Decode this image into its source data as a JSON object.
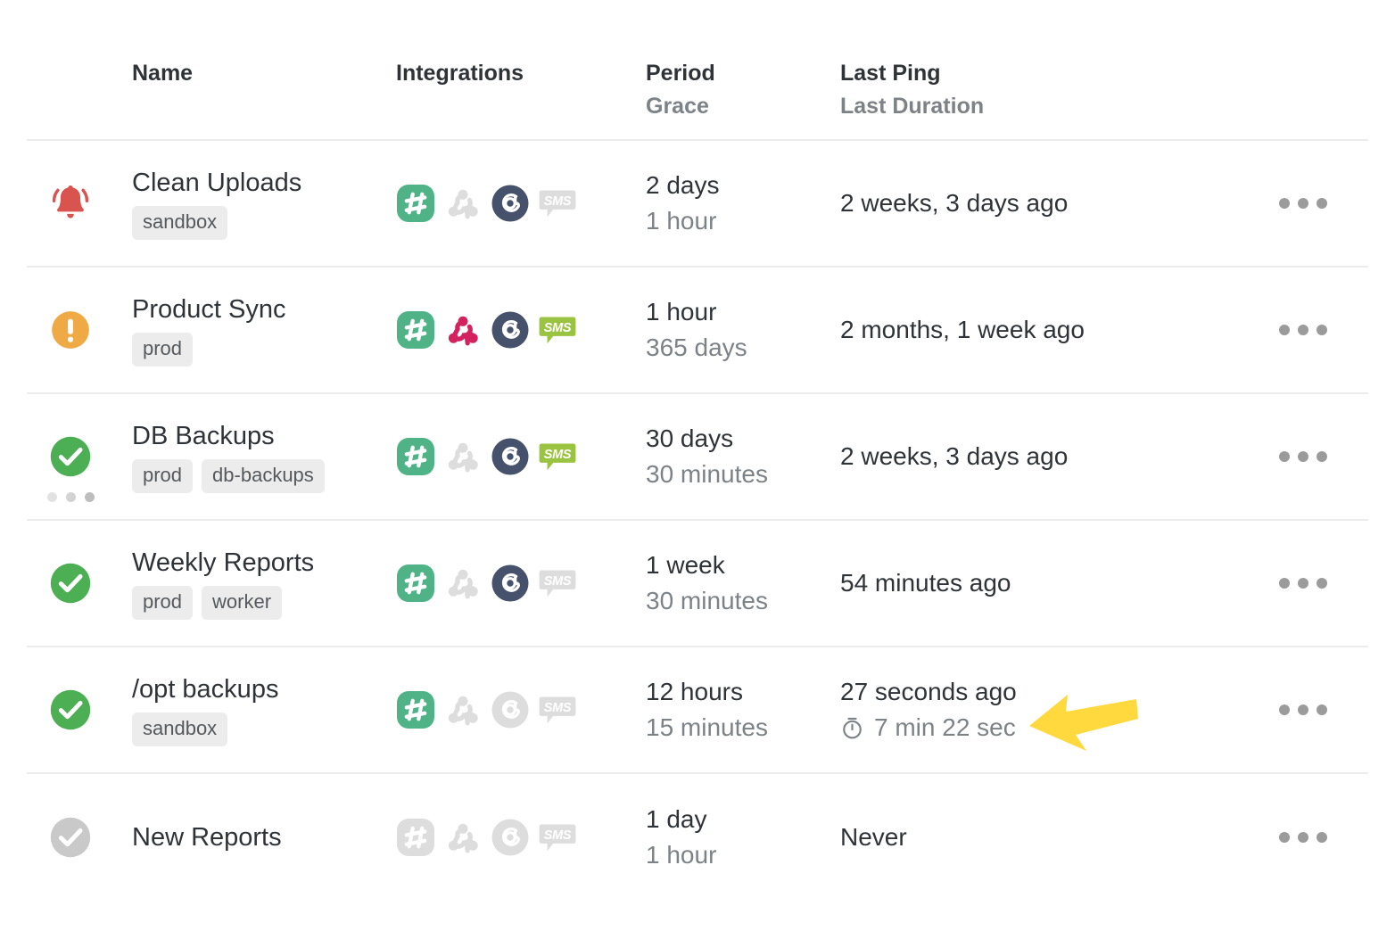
{
  "table": {
    "columns": [
      {
        "id": "status",
        "main": "",
        "sub": ""
      },
      {
        "id": "name",
        "main": "Name",
        "sub": ""
      },
      {
        "id": "integrations",
        "main": "Integrations",
        "sub": ""
      },
      {
        "id": "period",
        "main": "Period",
        "sub": "Grace"
      },
      {
        "id": "last_ping",
        "main": "Last Ping",
        "sub": "Last Duration"
      },
      {
        "id": "actions",
        "main": "",
        "sub": ""
      }
    ],
    "actions_label": "options-menu"
  },
  "colors": {
    "status_down": "#d9534f",
    "status_grace": "#efa945",
    "status_up": "#4caf54",
    "status_new": "#c9c9c9",
    "integration_slack_on": "#4fb387",
    "integration_webhook_on": "#d4225e",
    "integration_email_on": "#46526b",
    "integration_sms_on": "#9bc342",
    "integration_off": "#dddddd",
    "text_primary": "#2f3338",
    "text_muted": "#7d8287",
    "tag_bg": "#ececec",
    "row_divider": "#ececec",
    "annotation_arrow": "#ffd93d"
  },
  "rows": [
    {
      "status": "down",
      "status_icon": "alarm-bell-icon",
      "spinner": false,
      "name": "Clean Uploads",
      "tags": [
        "sandbox"
      ],
      "integrations": [
        {
          "icon": "slack-icon",
          "active": true
        },
        {
          "icon": "webhook-icon",
          "active": false
        },
        {
          "icon": "email-icon",
          "active": true
        },
        {
          "icon": "sms-icon",
          "active": false
        }
      ],
      "period": "2 days",
      "grace": "1 hour",
      "last_ping": "2 weeks, 3 days ago",
      "last_duration": ""
    },
    {
      "status": "grace",
      "status_icon": "exclamation-circle-icon",
      "spinner": false,
      "name": "Product Sync",
      "tags": [
        "prod"
      ],
      "integrations": [
        {
          "icon": "slack-icon",
          "active": true
        },
        {
          "icon": "webhook-icon",
          "active": true
        },
        {
          "icon": "email-icon",
          "active": true
        },
        {
          "icon": "sms-icon",
          "active": true
        }
      ],
      "period": "1 hour",
      "grace": "365 days",
      "last_ping": "2 months, 1 week ago",
      "last_duration": ""
    },
    {
      "status": "up",
      "status_icon": "check-circle-icon",
      "spinner": true,
      "name": "DB Backups",
      "tags": [
        "prod",
        "db-backups"
      ],
      "integrations": [
        {
          "icon": "slack-icon",
          "active": true
        },
        {
          "icon": "webhook-icon",
          "active": false
        },
        {
          "icon": "email-icon",
          "active": true
        },
        {
          "icon": "sms-icon",
          "active": true
        }
      ],
      "period": "30 days",
      "grace": "30 minutes",
      "last_ping": "2 weeks, 3 days ago",
      "last_duration": ""
    },
    {
      "status": "up",
      "status_icon": "check-circle-icon",
      "spinner": false,
      "name": "Weekly Reports",
      "tags": [
        "prod",
        "worker"
      ],
      "integrations": [
        {
          "icon": "slack-icon",
          "active": true
        },
        {
          "icon": "webhook-icon",
          "active": false
        },
        {
          "icon": "email-icon",
          "active": true
        },
        {
          "icon": "sms-icon",
          "active": false
        }
      ],
      "period": "1 week",
      "grace": "30 minutes",
      "last_ping": "54 minutes ago",
      "last_duration": ""
    },
    {
      "status": "up",
      "status_icon": "check-circle-icon",
      "spinner": false,
      "name": "/opt backups",
      "tags": [
        "sandbox"
      ],
      "integrations": [
        {
          "icon": "slack-icon",
          "active": true
        },
        {
          "icon": "webhook-icon",
          "active": false
        },
        {
          "icon": "email-icon",
          "active": false
        },
        {
          "icon": "sms-icon",
          "active": false
        }
      ],
      "period": "12 hours",
      "grace": "15 minutes",
      "last_ping": "27 seconds ago",
      "last_duration": "7 min 22 sec"
    },
    {
      "status": "new",
      "status_icon": "check-circle-icon",
      "spinner": false,
      "name": "New Reports",
      "tags": [],
      "integrations": [
        {
          "icon": "slack-icon",
          "active": false
        },
        {
          "icon": "webhook-icon",
          "active": false
        },
        {
          "icon": "email-icon",
          "active": false
        },
        {
          "icon": "sms-icon",
          "active": false
        }
      ],
      "period": "1 day",
      "grace": "1 hour",
      "last_ping": "Never",
      "last_duration": ""
    }
  ],
  "annotation": {
    "type": "arrow-cursor",
    "points_at": "last-duration-of-/opt-backups",
    "color": "#ffd93d"
  }
}
